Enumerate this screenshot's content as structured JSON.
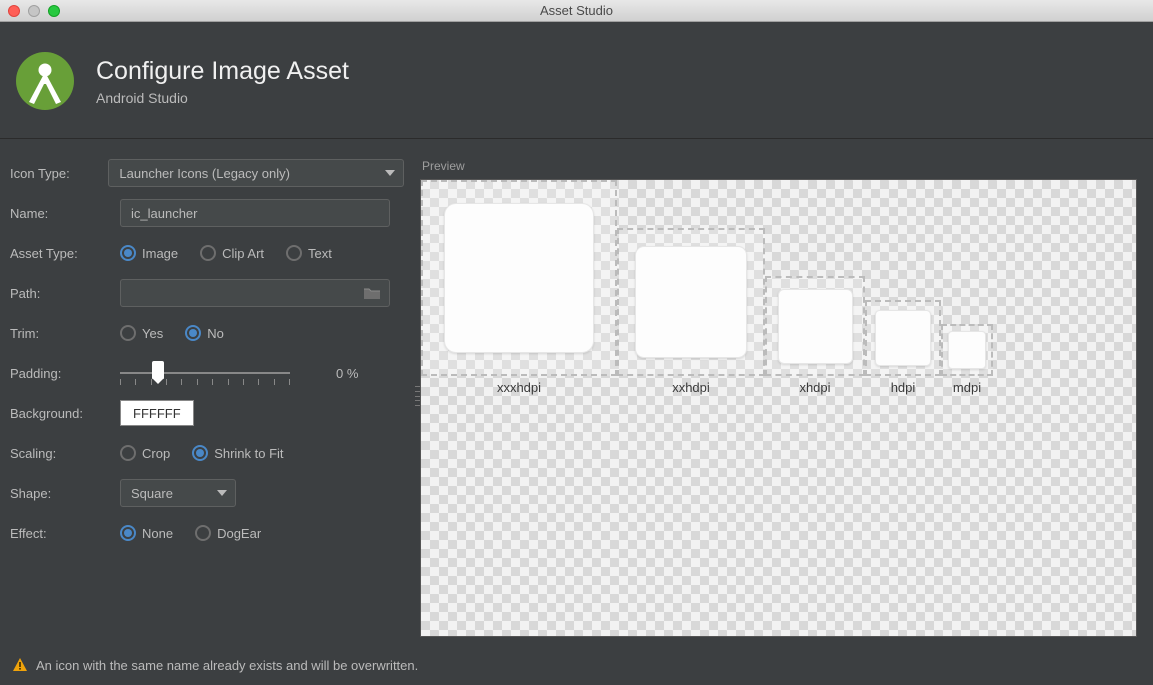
{
  "window": {
    "title": "Asset Studio"
  },
  "header": {
    "title": "Configure Image Asset",
    "subtitle": "Android Studio"
  },
  "form": {
    "iconType": {
      "label": "Icon Type:",
      "value": "Launcher Icons (Legacy only)"
    },
    "name": {
      "label": "Name:",
      "value": "ic_launcher"
    },
    "assetType": {
      "label": "Asset Type:",
      "options": {
        "image": "Image",
        "clipart": "Clip Art",
        "text": "Text"
      },
      "selected": "image"
    },
    "path": {
      "label": "Path:",
      "value": ""
    },
    "trim": {
      "label": "Trim:",
      "options": {
        "yes": "Yes",
        "no": "No"
      },
      "selected": "no"
    },
    "padding": {
      "label": "Padding:",
      "valueText": "0 %"
    },
    "background": {
      "label": "Background:",
      "value": "FFFFFF"
    },
    "scaling": {
      "label": "Scaling:",
      "options": {
        "crop": "Crop",
        "shrink": "Shrink to Fit"
      },
      "selected": "shrink"
    },
    "shape": {
      "label": "Shape:",
      "value": "Square"
    },
    "effect": {
      "label": "Effect:",
      "options": {
        "none": "None",
        "dogear": "DogEar"
      },
      "selected": "none"
    }
  },
  "preview": {
    "label": "Preview",
    "densities": [
      {
        "label": "xxxhdpi",
        "outer": 192,
        "inner": 150
      },
      {
        "label": "xxhdpi",
        "outer": 144,
        "inner": 112
      },
      {
        "label": "xhdpi",
        "outer": 96,
        "inner": 75
      },
      {
        "label": "hdpi",
        "outer": 72,
        "inner": 56
      },
      {
        "label": "mdpi",
        "outer": 48,
        "inner": 38
      }
    ]
  },
  "footer": {
    "warning": "An icon with the same name already exists and will be overwritten."
  }
}
